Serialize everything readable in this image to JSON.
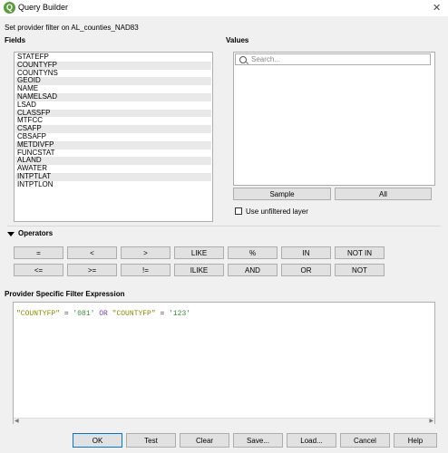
{
  "window": {
    "title": "Query Builder",
    "app_icon": "qgis-icon",
    "close_icon": "close-icon"
  },
  "description": "Set provider filter on AL_counties_NAD83",
  "fields": {
    "heading": "Fields",
    "items": [
      "STATEFP",
      "COUNTYFP",
      "COUNTYNS",
      "GEOID",
      "NAME",
      "NAMELSAD",
      "LSAD",
      "CLASSFP",
      "MTFCC",
      "CSAFP",
      "CBSAFP",
      "METDIVFP",
      "FUNCSTAT",
      "ALAND",
      "AWATER",
      "INTPTLAT",
      "INTPTLON"
    ]
  },
  "values": {
    "heading": "Values",
    "search_placeholder": "Search...",
    "sample_label": "Sample",
    "all_label": "All",
    "unfiltered_label": "Use unfiltered layer",
    "unfiltered_checked": false
  },
  "operators": {
    "heading": "Operators",
    "row1": [
      "=",
      "<",
      ">",
      "LIKE",
      "%",
      "IN",
      "NOT IN"
    ],
    "row2": [
      "<=",
      ">=",
      "!=",
      "ILIKE",
      "AND",
      "OR",
      "NOT"
    ]
  },
  "expression": {
    "heading": "Provider Specific Filter Expression",
    "tokens": [
      {
        "text": "\"COUNTYFP\"",
        "kind": "field"
      },
      {
        "text": " = ",
        "kind": "op"
      },
      {
        "text": "'081'",
        "kind": "str"
      },
      {
        "text": " OR ",
        "kind": "kw"
      },
      {
        "text": "\"COUNTYFP\"",
        "kind": "field"
      },
      {
        "text": " = ",
        "kind": "op"
      },
      {
        "text": "'123'",
        "kind": "str"
      }
    ]
  },
  "buttons": {
    "ok": "OK",
    "test": "Test",
    "clear": "Clear",
    "save": "Save...",
    "load": "Load...",
    "cancel": "Cancel",
    "help": "Help"
  }
}
